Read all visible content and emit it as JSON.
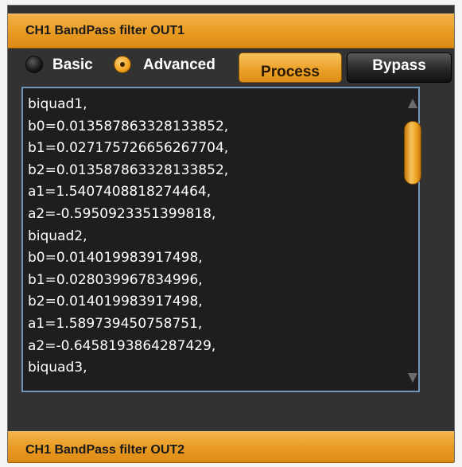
{
  "panel": {
    "header_title": "CH1 BandPass filter OUT1",
    "next_header_title": "CH1 BandPass filter OUT2"
  },
  "mode": {
    "basic_label": "Basic",
    "advanced_label": "Advanced",
    "selected": "Advanced"
  },
  "buttons": {
    "process_label": "Process",
    "bypass_label": "Bypass",
    "active": "Process"
  },
  "coefficients": {
    "lines": [
      "biquad1,",
      "b0=0.013587863328133852,",
      "b1=0.027175726656267704,",
      "b2=0.013587863328133852,",
      "a1=1.5407408818274464,",
      "a2=-0.5950923351399818,",
      "biquad2,",
      "b0=0.014019983917498,",
      "b1=0.028039967834996,",
      "b2=0.014019983917498,",
      "a1=1.589739450758751,",
      "a2=-0.6458193864287429,",
      "biquad3,"
    ]
  },
  "colors": {
    "accent_orange": "#eba22b",
    "panel_bg": "#323232",
    "textarea_bg": "#1e1e1e",
    "textarea_border": "#6f95b8"
  },
  "icons": {
    "radio_off": "radio-unselected-icon",
    "radio_on": "radio-selected-icon",
    "scroll_up": "triangle-up-icon",
    "scroll_down": "triangle-down-icon"
  }
}
